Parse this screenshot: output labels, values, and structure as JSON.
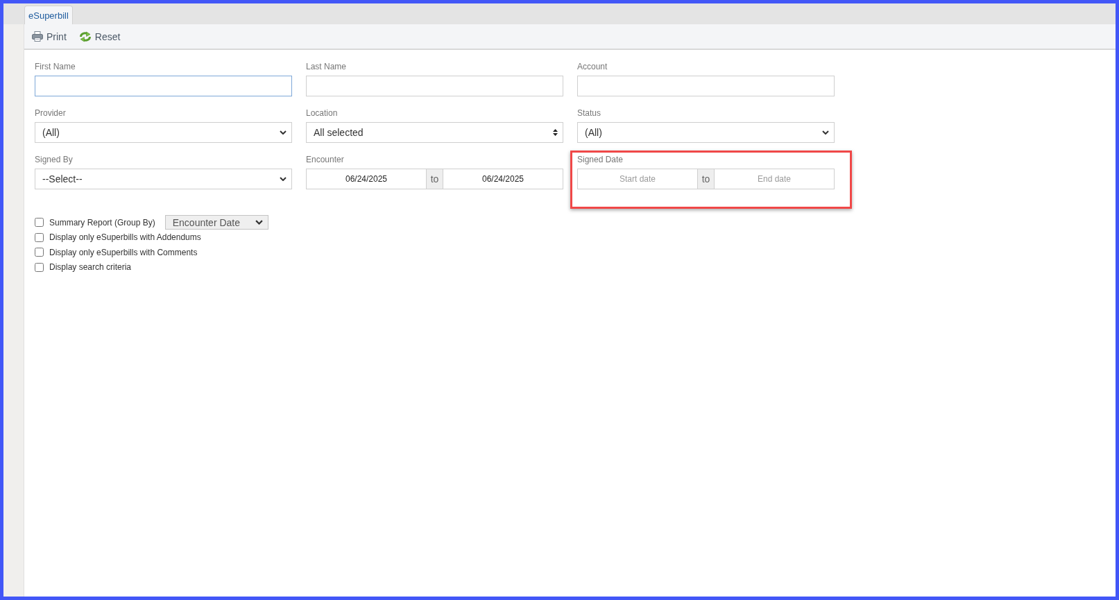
{
  "tabs": [
    {
      "label": "eSuperbill",
      "selected": true
    }
  ],
  "toolbar": [
    {
      "kind": "print",
      "label": "Print"
    },
    {
      "kind": "reset",
      "label": "Reset"
    }
  ],
  "fields": [
    {
      "kind": "text",
      "label": "First Name",
      "focused": true
    },
    {
      "kind": "text",
      "label": "Last Name",
      "focused": false
    },
    {
      "kind": "text",
      "label": "Account",
      "focused": false
    },
    {
      "kind": "select",
      "label": "Provider",
      "value": "(All)"
    },
    {
      "kind": "multiselect",
      "label": "Location",
      "value": "All selected"
    },
    {
      "kind": "select",
      "label": "Status",
      "value": "(All)"
    },
    {
      "kind": "select",
      "label": "Signed By",
      "value": "--Select--"
    },
    {
      "kind": "daterange",
      "label": "Encounter",
      "start": {
        "value": "06/24/2025"
      },
      "separator": "to",
      "end": {
        "value": "06/24/2025"
      },
      "highlighted": false
    },
    {
      "kind": "daterange",
      "label": "Signed Date",
      "start": {
        "placeholder": "Start date"
      },
      "separator": "to",
      "end": {
        "placeholder": "End date"
      },
      "highlighted": true
    }
  ],
  "options": [
    {
      "label": "Summary Report (Group By)",
      "checked": false,
      "group_by": {
        "value": "Encounter Date"
      }
    },
    {
      "label": "Display only eSuperbills with Addendums",
      "checked": false
    },
    {
      "label": "Display only eSuperbills with Comments",
      "checked": false
    },
    {
      "label": "Display search criteria",
      "checked": false
    }
  ]
}
